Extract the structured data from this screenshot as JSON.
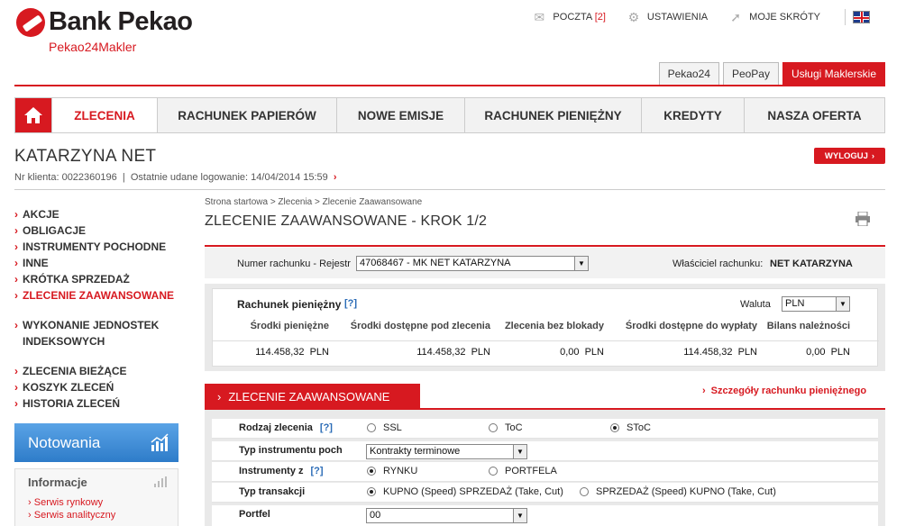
{
  "brand": {
    "name": "Bank Pekao",
    "sub": "Pekao24Makler",
    "color": "#d71920"
  },
  "toplinks": {
    "mail_label": "POCZTA",
    "mail_count": "[2]",
    "settings_label": "USTAWIENIA",
    "shortcuts_label": "MOJE SKRÓTY"
  },
  "portal_tabs": [
    "Pekao24",
    "PeoPay",
    "Usługi Maklerskie"
  ],
  "nav": [
    "ZLECENIA",
    "RACHUNEK PAPIERÓW",
    "NOWE EMISJE",
    "RACHUNEK PIENIĘŻNY",
    "KREDYTY",
    "NASZA OFERTA"
  ],
  "user": {
    "name": "KATARZYNA NET",
    "client_no": "Nr klienta: 0022360196",
    "last_login": "Ostatnie udane logowanie: 14/04/2014 15:59",
    "logout": "WYLOGUJ"
  },
  "sidebar": {
    "group1": [
      "AKCJE",
      "OBLIGACJE",
      "INSTRUMENTY POCHODNE",
      "INNE",
      "KRÓTKA SPRZEDAŻ",
      "ZLECENIE ZAAWANSOWANE"
    ],
    "group2": [
      "WYKONANIE JEDNOSTEK INDEKSOWYCH"
    ],
    "group3": [
      "ZLECENIA BIEŻĄCE",
      "KOSZYK ZLECEŃ",
      "HISTORIA ZLECEŃ"
    ]
  },
  "widgets": {
    "notowania": "Notowania",
    "info_title": "Informacje",
    "info_links": [
      "Serwis rynkowy",
      "Serwis analityczny"
    ]
  },
  "breadcrumb": "Strona startowa > Zlecenia > Zlecenie Zaawansowane",
  "page_title": "ZLECENIE ZAAWANSOWANE - KROK 1/2",
  "account": {
    "label": "Numer rachunku - Rejestr",
    "value": "47068467 - MK NET KATARZYNA",
    "owner_label": "Właściciel rachunku:",
    "owner": "NET KATARZYNA"
  },
  "money": {
    "title": "Rachunek pieniężny",
    "help": "[?]",
    "currency_label": "Waluta",
    "currency": "PLN",
    "headers": [
      "Środki pieniężne",
      "Środki dostępne pod zlecenia",
      "Zlecenia bez blokady",
      "Środki dostępne do wypłaty",
      "Bilans należności"
    ],
    "values": [
      "114.458,32  PLN",
      "114.458,32  PLN",
      "0,00  PLN",
      "114.458,32  PLN",
      "0,00  PLN"
    ]
  },
  "order": {
    "tab": "ZLECENIE ZAAWANSOWANE",
    "details_link": "Szczegóły rachunku pieniężnego",
    "type_label": "Rodzaj zlecenia",
    "type_help": "[?]",
    "type_options": [
      "SSL",
      "ToC",
      "SToC"
    ],
    "instr_type_label": "Typ instrumentu poch",
    "instr_type_value": "Kontrakty terminowe",
    "instr_from_label": "Instrumenty z",
    "instr_from_help": "[?]",
    "instr_from_options": [
      "RYNKU",
      "PORTFELA"
    ],
    "tx_label": "Typ transakcji",
    "tx_options": [
      "KUPNO (Speed) SPRZEDAŻ (Take, Cut)",
      "SPRZEDAŻ (Speed) KUPNO (Take, Cut)"
    ],
    "portfolio_label": "Portfel",
    "portfolio_value": "00"
  }
}
